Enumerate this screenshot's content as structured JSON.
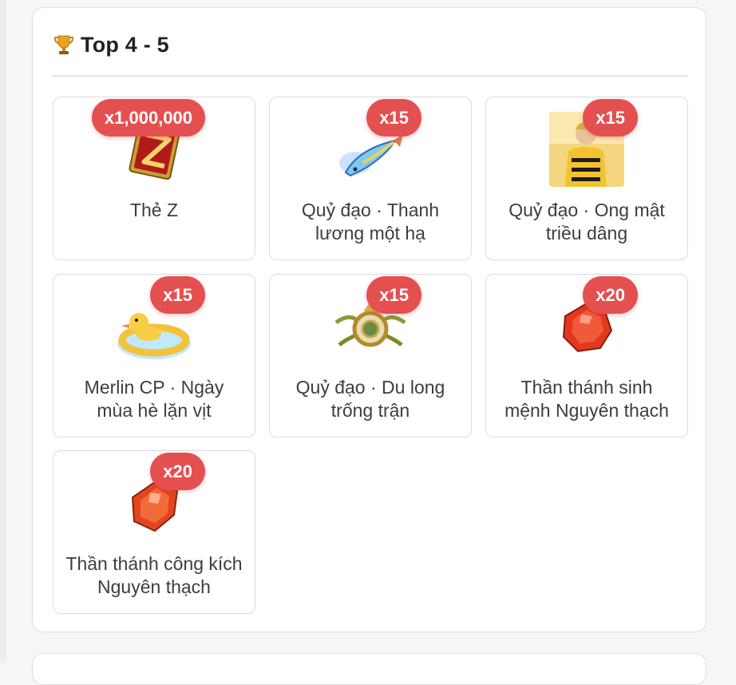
{
  "section": {
    "icon": "trophy-icon",
    "title": "Top 4 - 5"
  },
  "colors": {
    "badge": "#e45050",
    "card_border": "#d9dce0",
    "text": "#3a3d42"
  },
  "rewards": [
    {
      "name": "Thẻ Z",
      "quantity": "x1,000,000",
      "icon": "z-card-icon"
    },
    {
      "name": "Quỷ đạo · Thanh lương một hạ",
      "quantity": "x15",
      "icon": "fish-trail-icon"
    },
    {
      "name": "Quỷ đạo · Ong mật triều dâng",
      "quantity": "x15",
      "icon": "bee-character-icon"
    },
    {
      "name": "Merlin CP · Ngày mùa hè lặn vịt",
      "quantity": "x15",
      "icon": "duck-float-icon"
    },
    {
      "name": "Quỷ đạo · Du long trống trận",
      "quantity": "x15",
      "icon": "dragon-drum-icon"
    },
    {
      "name": "Thần thánh sinh mệnh Nguyên thạch",
      "quantity": "x20",
      "icon": "red-gem-round-icon"
    },
    {
      "name": "Thần thánh công kích Nguyên thạch",
      "quantity": "x20",
      "icon": "red-gem-hex-icon"
    }
  ]
}
